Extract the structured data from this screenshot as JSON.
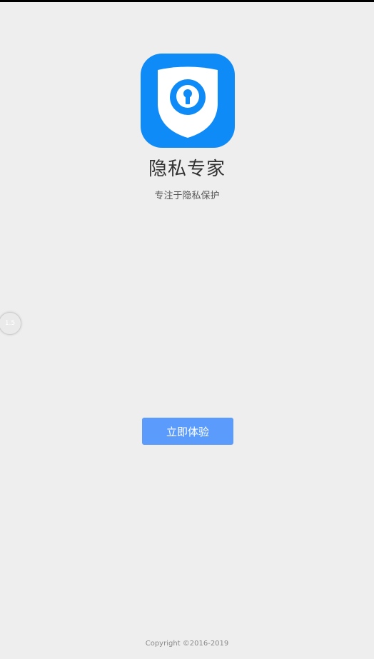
{
  "app": {
    "title": "隐私专家",
    "subtitle": "专注于隐私保护"
  },
  "floating_ball": {
    "label": "1.5"
  },
  "actions": {
    "start_label": "立即体验"
  },
  "footer": {
    "copyright": "Copyright ©2016-2019"
  },
  "icons": {
    "app_icon": "shield-keyhole-icon"
  },
  "colors": {
    "background": "#eeeeee",
    "icon_blue": "#0f8bf7",
    "button_blue": "#5b9bfb",
    "title_text": "#333333"
  }
}
